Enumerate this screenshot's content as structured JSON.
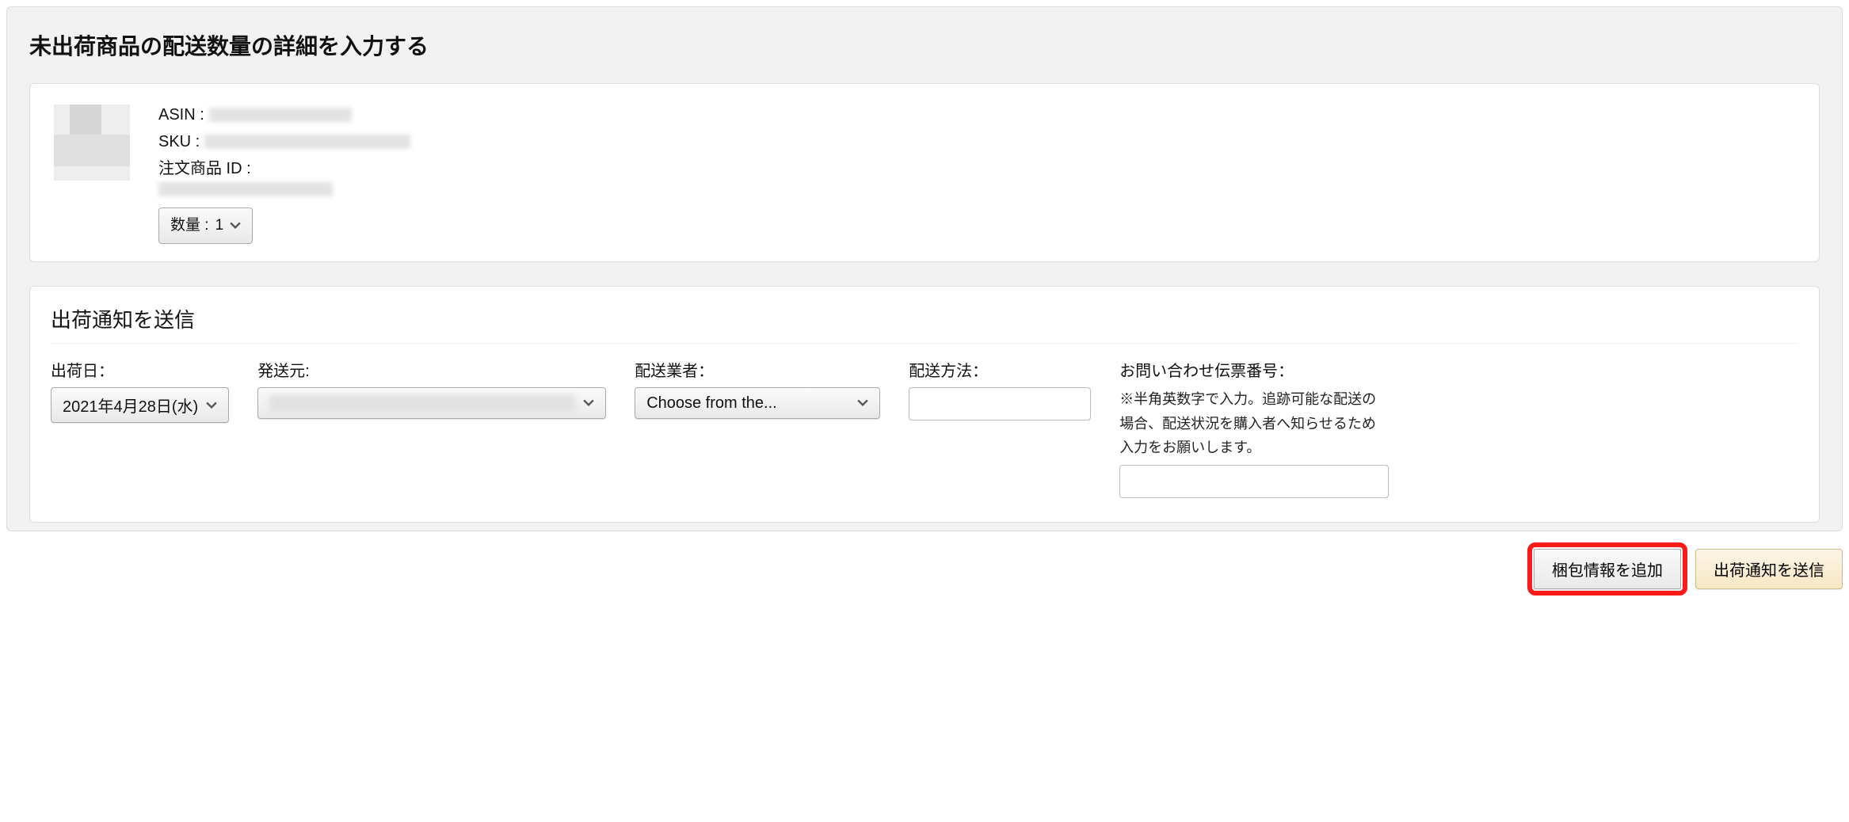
{
  "page": {
    "title": "未出荷商品の配送数量の詳細を入力する"
  },
  "product": {
    "asin_label": "ASIN :",
    "sku_label": "SKU :",
    "order_item_id_label": "注文商品 ID :",
    "quantity_label": "数量 :",
    "quantity_value": "1"
  },
  "shipping": {
    "section_title": "出荷通知を送信",
    "ship_date_label": "出荷日：",
    "ship_date_value": "2021年4月28日(水)",
    "ship_from_label": "発送元:",
    "carrier_label": "配送業者：",
    "carrier_value": "Choose from the...",
    "method_label": "配送方法：",
    "tracking_label": "お問い合わせ伝票番号：",
    "tracking_hint": "※半角英数字で入力。追跡可能な配送の場合、配送状況を購入者へ知らせるため入力をお願いします。"
  },
  "actions": {
    "add_packaging": "梱包情報を追加",
    "send_notice": "出荷通知を送信"
  }
}
